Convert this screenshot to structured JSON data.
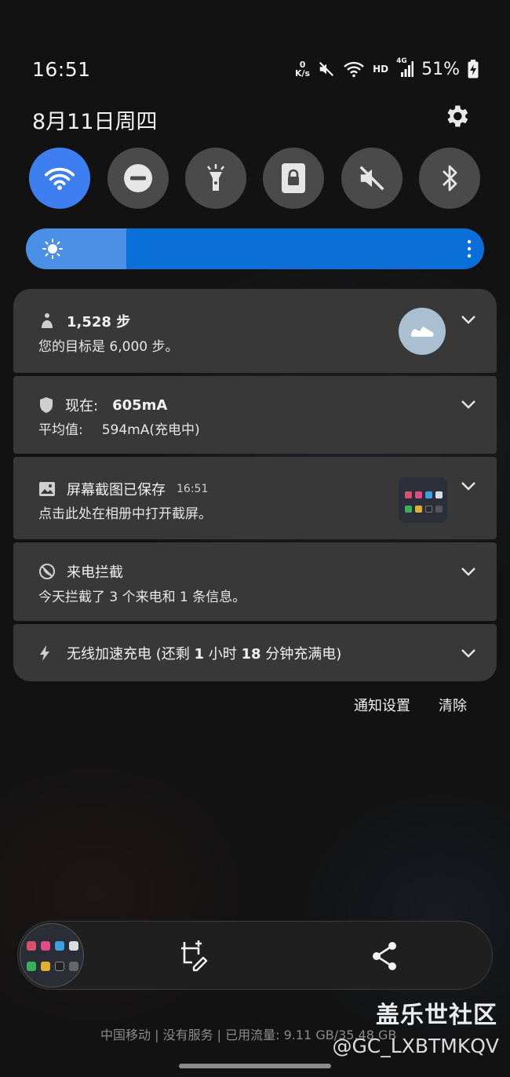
{
  "status_bar": {
    "time": "16:51",
    "net_speed_value": "0",
    "net_speed_unit": "K/s",
    "hd_label": "HD",
    "network_type": "4G",
    "battery_percent": "51%",
    "icons": [
      "mute-icon",
      "wifi-icon",
      "signal-icon",
      "battery-charging-icon"
    ]
  },
  "header": {
    "date": "8月11日周四",
    "settings_icon": "gear-icon"
  },
  "quick_settings": {
    "tiles": [
      {
        "name": "wifi",
        "icon": "wifi-icon",
        "active": true
      },
      {
        "name": "do-not-disturb",
        "icon": "do-not-disturb-icon",
        "active": false
      },
      {
        "name": "flashlight",
        "icon": "flashlight-icon",
        "active": false
      },
      {
        "name": "screen-lock",
        "icon": "lock-icon",
        "active": false
      },
      {
        "name": "sound",
        "icon": "mute-icon",
        "active": false
      },
      {
        "name": "bluetooth",
        "icon": "bluetooth-icon",
        "active": false
      }
    ],
    "active_color": "#3d7ef0",
    "inactive_color": "#4a4a4a"
  },
  "brightness": {
    "level": 0.22,
    "track_color": "#0a6fd8",
    "fill_color": "#4a90e6"
  },
  "notifications": [
    {
      "id": "steps",
      "icon": "walking-person-icon",
      "title": "1,528 步",
      "body": "您的目标是 6,000 步。",
      "side_icon": "shoe-icon"
    },
    {
      "id": "current",
      "icon": "shield-icon",
      "title_label": "现在:",
      "title_value": "605mA",
      "body_label": "平均值:",
      "body_value": "594mA(充电中)"
    },
    {
      "id": "screenshot",
      "icon": "image-icon",
      "title": "屏幕截图已保存",
      "time": "16:51",
      "body": "点击此处在相册中打开截屏。"
    },
    {
      "id": "call-block",
      "icon": "blocked-call-icon",
      "title": "来电拦截",
      "body": "今天拦截了 3 个来电和 1 条信息。"
    },
    {
      "id": "charging",
      "icon": "lightning-icon",
      "title_prefix": "无线加速充电 (还剩 ",
      "hours": "1",
      "hours_unit": " 小时 ",
      "minutes": "18",
      "title_suffix": " 分钟充满电)"
    }
  ],
  "actions": {
    "settings_label": "通知设置",
    "clear_label": "清除"
  },
  "capture_toolbar": {
    "icons": [
      "scroll-capture-icon",
      "share-icon"
    ]
  },
  "footer": {
    "carrier_text": "中国移动 | 没有服务 | 已用流量: 9.11 GB/35.48 GB",
    "watermark_title": "盖乐世社区",
    "watermark_handle": "@GC_LXBTMKQV"
  }
}
